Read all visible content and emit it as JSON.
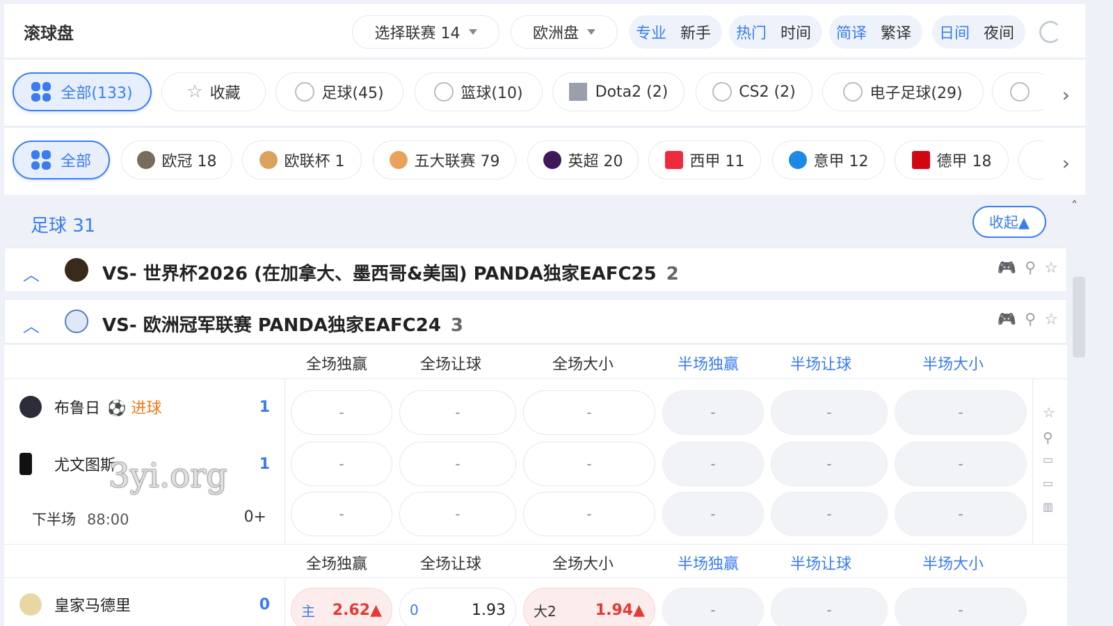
{
  "header": {
    "title": "滚球盘",
    "league_select": "选择联赛 14",
    "odds_select": "欧洲盘",
    "mode": {
      "a": "专业",
      "b": "新手"
    },
    "sort": {
      "a": "热门",
      "b": "时间"
    },
    "lang": {
      "a": "简译",
      "b": "繁译"
    },
    "theme": {
      "a": "日间",
      "b": "夜间"
    }
  },
  "sport_tabs": [
    {
      "label": "全部(133)",
      "icon": "grid-icon",
      "active": true
    },
    {
      "label": "收藏",
      "icon": "star-icon"
    },
    {
      "label": "足球(45)",
      "icon": "soccer-ball-icon"
    },
    {
      "label": "篮球(10)",
      "icon": "basketball-icon"
    },
    {
      "label": "Dota2 (2)",
      "icon": "dota2-icon"
    },
    {
      "label": "CS2 (2)",
      "icon": "cs2-icon"
    },
    {
      "label": "电子足球(29)",
      "icon": "esoccer-icon"
    }
  ],
  "league_tabs": [
    {
      "label": "全部",
      "icon": "grid-icon",
      "active": true
    },
    {
      "label": "欧冠 18",
      "icon": "ucl-icon"
    },
    {
      "label": "欧联杯 1",
      "icon": "uel-icon"
    },
    {
      "label": "五大联赛 79",
      "icon": "top5-icon"
    },
    {
      "label": "英超 20",
      "icon": "premier-league-icon"
    },
    {
      "label": "西甲 11",
      "icon": "laliga-icon"
    },
    {
      "label": "意甲 12",
      "icon": "serie-a-icon"
    },
    {
      "label": "德甲 18",
      "icon": "bundesliga-icon"
    }
  ],
  "section": {
    "title": "足球 31",
    "collapse_label": "收起▲"
  },
  "leagues": [
    {
      "name": "VS- 世界杯2026 (在加拿大、墨西哥&美国) PANDA独家EAFC25",
      "count": "2"
    },
    {
      "name": "VS- 欧洲冠军联赛 PANDA独家EAFC24",
      "count": "3"
    }
  ],
  "market_headers": [
    "全场独赢",
    "全场让球",
    "全场大小",
    "半场独赢",
    "半场让球",
    "半场大小"
  ],
  "match1": {
    "home": "布鲁日",
    "home_score": "1",
    "goal_label": "进球",
    "away": "尤文图斯",
    "away_score": "1",
    "period": "下半场",
    "time": "88:00",
    "more": "0+",
    "dash": "-"
  },
  "match2": {
    "home": "皇家马德里",
    "home_score": "0",
    "odds": [
      {
        "label": "主",
        "value": "2.62▲"
      },
      {
        "label": "0",
        "value": "1.93"
      },
      {
        "label": "大2",
        "value": "1.94▲"
      }
    ]
  },
  "watermark": "3yi.org",
  "colors": {
    "accent": "#3a7bf0",
    "red": "#e53935",
    "orange": "#f07a1e"
  }
}
